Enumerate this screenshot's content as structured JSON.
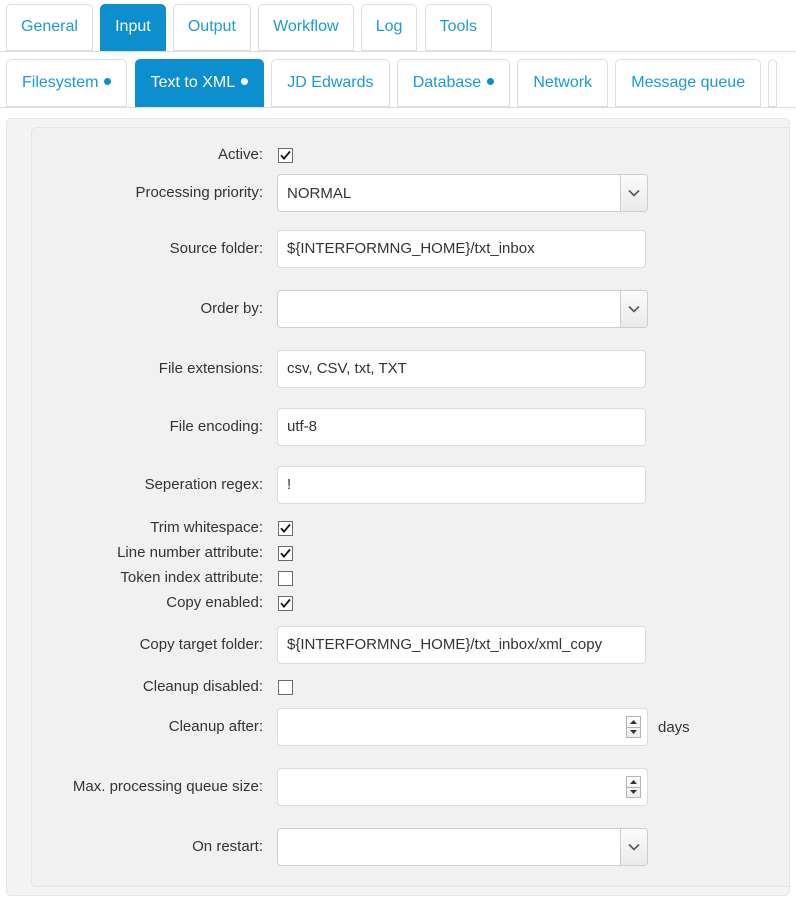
{
  "primary_tabs": [
    {
      "label": "General",
      "active": false
    },
    {
      "label": "Input",
      "active": true
    },
    {
      "label": "Output",
      "active": false
    },
    {
      "label": "Workflow",
      "active": false
    },
    {
      "label": "Log",
      "active": false
    },
    {
      "label": "Tools",
      "active": false
    }
  ],
  "secondary_tabs": [
    {
      "label": "Filesystem",
      "active": false,
      "dot": true
    },
    {
      "label": "Text to XML",
      "active": true,
      "dot": true
    },
    {
      "label": "JD Edwards",
      "active": false,
      "dot": false
    },
    {
      "label": "Database",
      "active": false,
      "dot": true
    },
    {
      "label": "Network",
      "active": false,
      "dot": false
    },
    {
      "label": "Message queue",
      "active": false,
      "dot": false
    }
  ],
  "form": {
    "active": {
      "label": "Active:",
      "checked": true
    },
    "processing_priority": {
      "label": "Processing priority:",
      "value": "NORMAL",
      "options": [
        "NORMAL"
      ]
    },
    "source_folder": {
      "label": "Source folder:",
      "value": "${INTERFORMNG_HOME}/txt_inbox",
      "placeholder": ""
    },
    "order_by": {
      "label": "Order by:",
      "value": "",
      "options": []
    },
    "file_extensions": {
      "label": "File extensions:",
      "value": "csv, CSV, txt, TXT",
      "placeholder": ""
    },
    "file_encoding": {
      "label": "File encoding:",
      "value": "utf-8",
      "placeholder": ""
    },
    "seperation_regex": {
      "label": "Seperation regex:",
      "value": "!",
      "placeholder": ""
    },
    "trim_whitespace": {
      "label": "Trim whitespace:",
      "checked": true
    },
    "line_number_attribute": {
      "label": "Line number attribute:",
      "checked": true
    },
    "token_index_attribute": {
      "label": "Token index attribute:",
      "checked": false
    },
    "copy_enabled": {
      "label": "Copy enabled:",
      "checked": true
    },
    "copy_target_folder": {
      "label": "Copy target folder:",
      "value": "${INTERFORMNG_HOME}/txt_inbox/xml_copy",
      "placeholder": ""
    },
    "cleanup_disabled": {
      "label": "Cleanup disabled:",
      "checked": false
    },
    "cleanup_after": {
      "label": "Cleanup after:",
      "value": "",
      "suffix": "days"
    },
    "max_processing_queue_size": {
      "label": "Max. processing queue size:",
      "value": ""
    },
    "on_restart": {
      "label": "On restart:",
      "value": "",
      "options": []
    }
  },
  "colors": {
    "accent": "#0d8ecf",
    "link": "#1a9ad7",
    "panel_bg": "#f1f1f1",
    "text": "#333333"
  }
}
